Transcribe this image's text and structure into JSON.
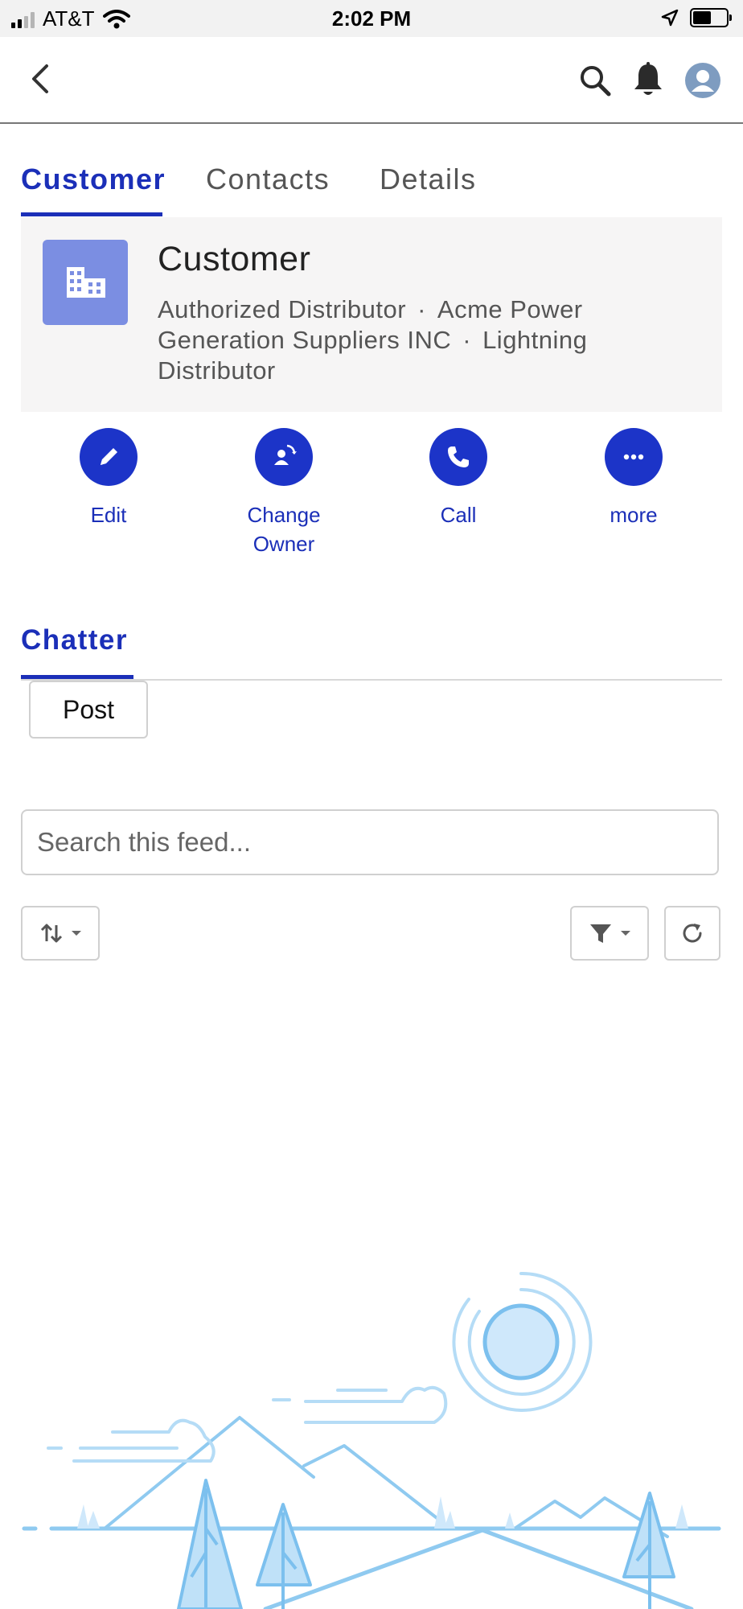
{
  "status_bar": {
    "carrier": "AT&T",
    "time": "2:02 PM"
  },
  "header": {
    "icons": [
      "back-icon",
      "search-icon",
      "bell-icon",
      "avatar-icon"
    ]
  },
  "tabs": [
    {
      "label": "Customer",
      "active": true
    },
    {
      "label": "Contacts",
      "active": false
    },
    {
      "label": "Details",
      "active": false
    }
  ],
  "record": {
    "title": "Customer",
    "icon": "building-icon",
    "icon_color": "#7b8ee2",
    "fields": [
      "Authorized Distributor",
      "Acme Power Generation Suppliers INC",
      "Lightning Distributor"
    ]
  },
  "actions": [
    {
      "label": "Edit",
      "icon": "pencil-icon"
    },
    {
      "label": "Change Owner",
      "icon": "change-owner-icon"
    },
    {
      "label": "Call",
      "icon": "phone-icon"
    },
    {
      "label": "more",
      "icon": "more-icon"
    }
  ],
  "chatter": {
    "tab_label": "Chatter",
    "post_label": "Post",
    "search_placeholder": "Search this feed..."
  },
  "colors": {
    "accent": "#1b2fb8",
    "action_button": "#1c34c8",
    "card_background": "#f6f5f5",
    "illustration": "#8fcaf0"
  }
}
